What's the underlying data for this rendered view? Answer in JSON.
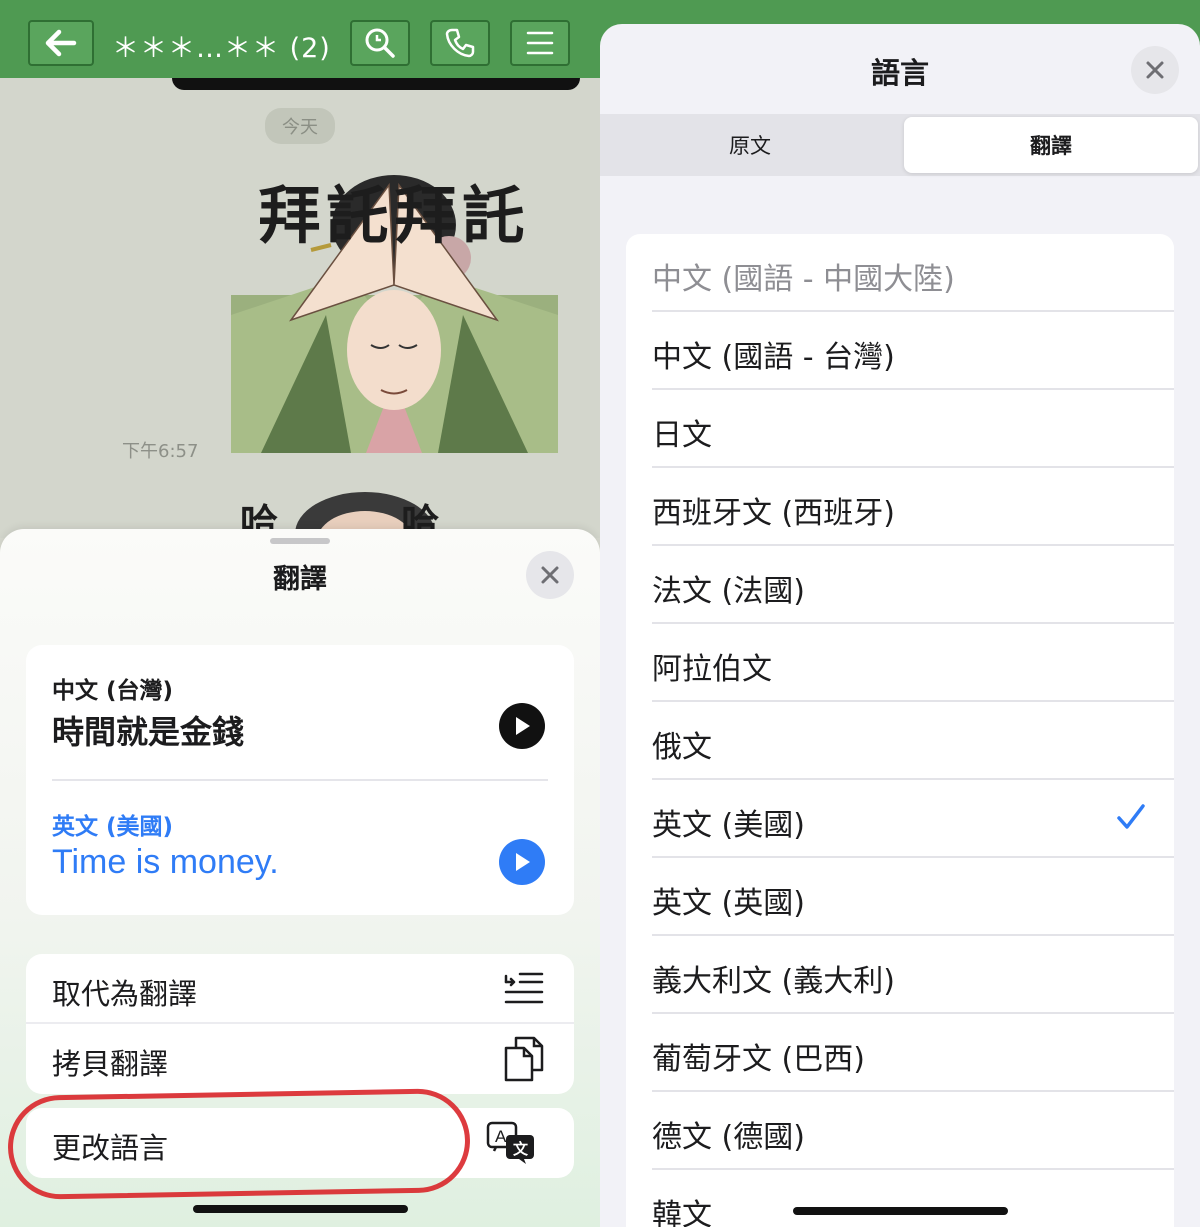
{
  "chat": {
    "title": "＊＊＊…＊＊ (2)",
    "day_label": "今天",
    "sticker_caption": "拜託拜託",
    "message_time": "下午6:57",
    "sticker2_caption": "哈 哈"
  },
  "translate_sheet": {
    "title": "翻譯",
    "source_lang": "中文 (台灣)",
    "source_text": "時間就是金錢",
    "target_lang": "英文 (美國)",
    "target_text": "Time is money.",
    "actions": {
      "replace": "取代為翻譯",
      "copy": "拷貝翻譯",
      "change_language": "更改語言"
    },
    "accent_color": "#2f7cf6"
  },
  "language_sheet": {
    "title": "語言",
    "segments": [
      "原文",
      "翻譯"
    ],
    "selected_segment": "翻譯",
    "languages": [
      "中文 (國語 - 中國大陸)",
      "中文 (國語 - 台灣)",
      "日文",
      "西班牙文 (西班牙)",
      "法文 (法國)",
      "阿拉伯文",
      "俄文",
      "英文 (美國)",
      "英文 (英國)",
      "義大利文 (義大利)",
      "葡萄牙文 (巴西)",
      "德文 (德國)",
      "韓文"
    ],
    "disabled_language": "中文 (國語 - 中國大陸)",
    "selected_language": "英文 (美國)",
    "checkmark_color": "#2f7cf6"
  },
  "icons": {
    "back": "arrow-left-icon",
    "search": "search-icon",
    "call": "phone-icon",
    "menu": "hamburger-menu-icon",
    "close": "close-icon",
    "play": "play-icon",
    "replace": "replace-text-icon",
    "copy": "copy-icon",
    "translate": "translate-icon",
    "check": "checkmark-icon"
  },
  "theme": {
    "topbar_green": "#4f9a52",
    "highlight_ring_red": "#d9262a"
  }
}
